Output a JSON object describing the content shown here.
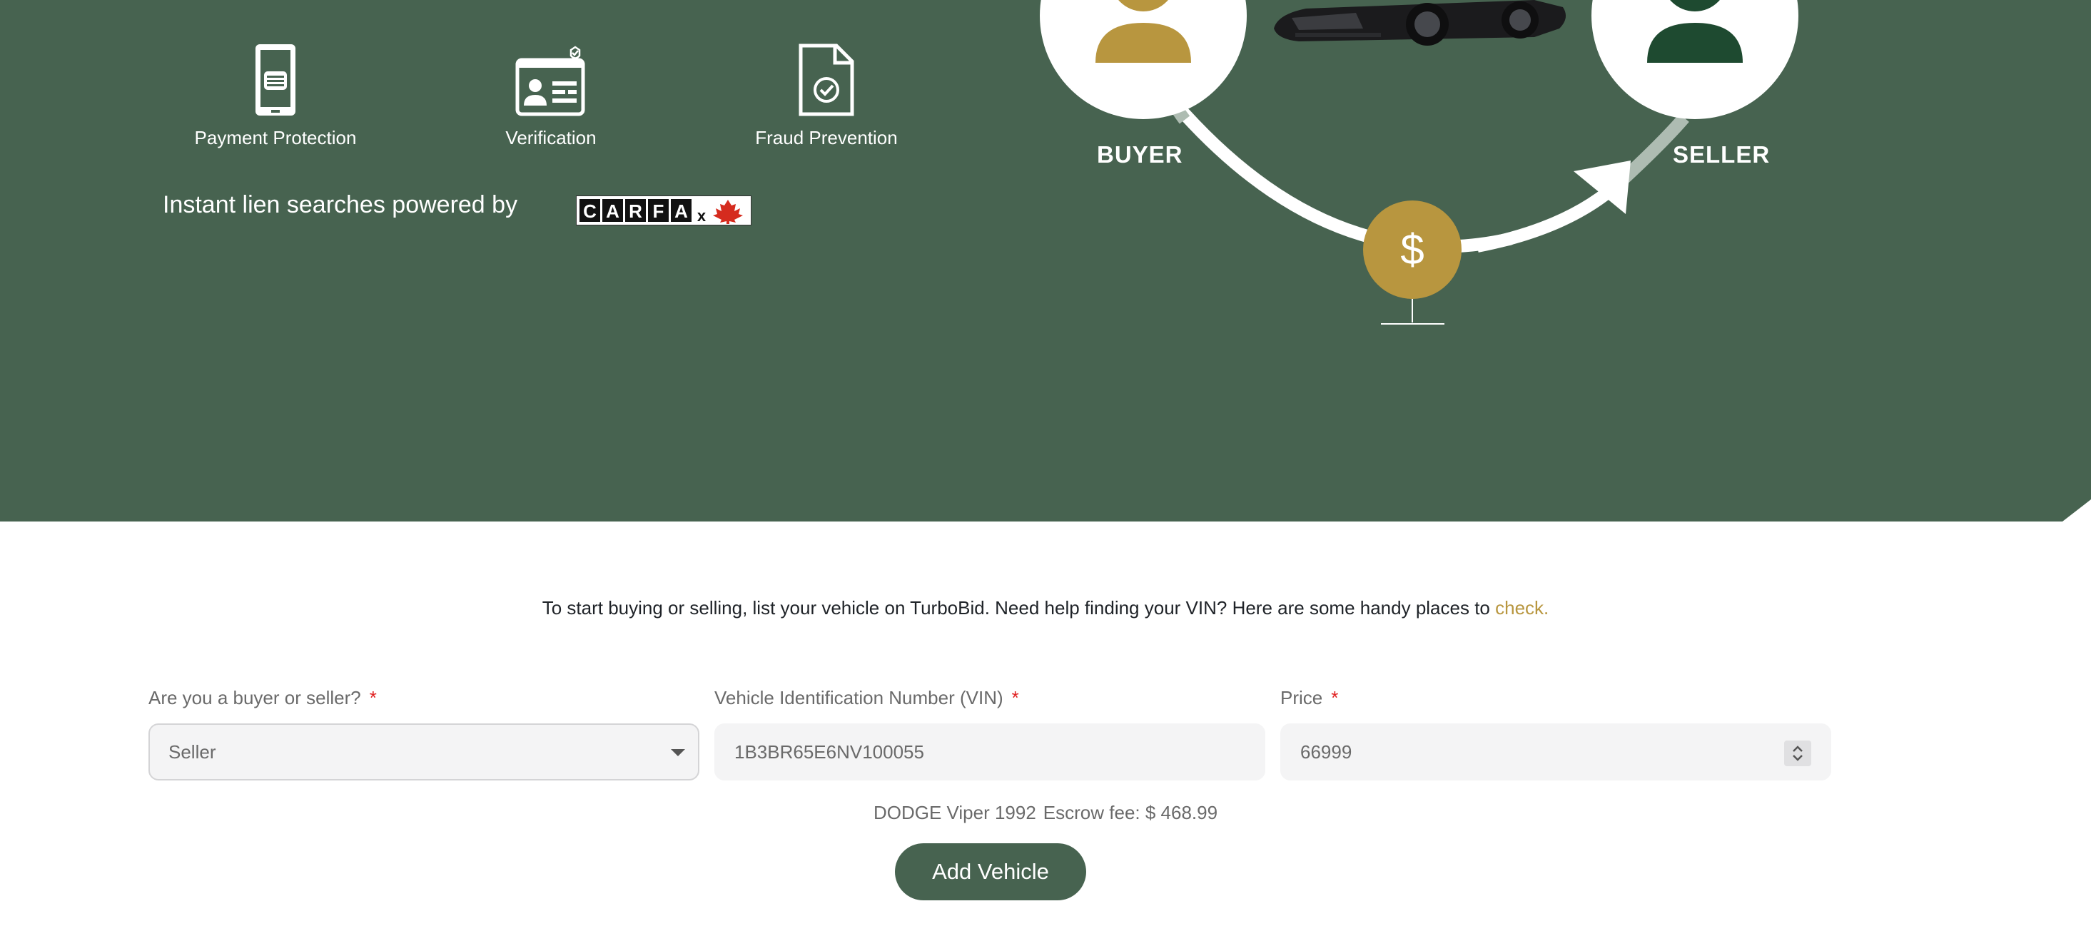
{
  "features": [
    {
      "label": "Payment Protection",
      "icon": "phone-card-icon"
    },
    {
      "label": "Verification",
      "icon": "id-card-icon"
    },
    {
      "label": "Fraud Prevention",
      "icon": "document-check-icon"
    }
  ],
  "lien_text": "Instant lien searches powered by",
  "carfax": {
    "logo_letters": [
      "C",
      "A",
      "R",
      "F",
      "A",
      "x"
    ]
  },
  "diagram": {
    "buyer_label": "BUYER",
    "seller_label": "SELLER",
    "currency_symbol": "$"
  },
  "intro": {
    "text": "To start buying or selling, list your vehicle on TurboBid. Need help finding your VIN? Here are some handy places to",
    "link": "check."
  },
  "form": {
    "role": {
      "label": "Are you a buyer or seller?",
      "value": "Seller"
    },
    "vin": {
      "label": "Vehicle Identification Number (VIN)",
      "value": "1B3BR65E6NV100055"
    },
    "price": {
      "label": "Price",
      "value": "66999"
    },
    "required_mark": "*"
  },
  "summary": {
    "vehicle": "DODGE Viper 1992",
    "fee": "Escrow fee: $ 468.99"
  },
  "add_button": "Add Vehicle",
  "colors": {
    "hero_bg": "#476350",
    "gold": "#b8963f",
    "seller_green": "#1e4a30",
    "button_bg": "#476350"
  }
}
